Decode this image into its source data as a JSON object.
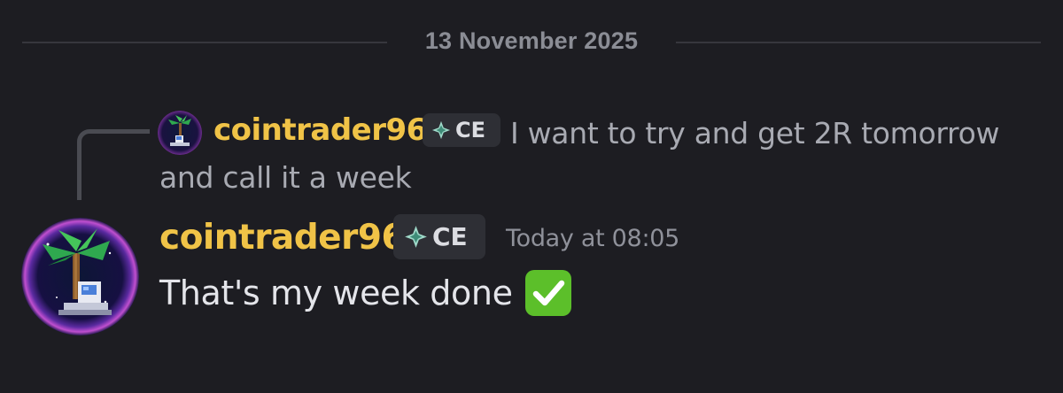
{
  "divider": {
    "date": "13 November 2025"
  },
  "reply": {
    "username": "cointrader96",
    "tag": "CE",
    "text": "I want to try and get 2R tomorrow and call it a week"
  },
  "message": {
    "username": "cointrader96",
    "tag": "CE",
    "timestamp": "Today at 08:05",
    "text": "That's my week done",
    "emoji": "check-mark-button-icon"
  },
  "colors": {
    "background": "#1d1d22",
    "username": "#f0c347",
    "tag_bg": "#2e2f35",
    "check_green": "#5cbf2a"
  }
}
